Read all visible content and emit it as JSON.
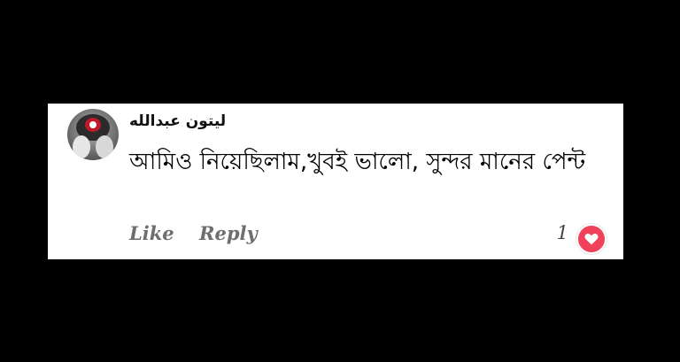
{
  "comment": {
    "author_name": "ليتون عبدالله",
    "text": "আমিও নিয়েছিলাম,খুবই ভালো, সুন্দর মানের পেন্ট",
    "actions": {
      "like_label": "Like",
      "reply_label": "Reply"
    },
    "reactions": {
      "count": "1",
      "icon": "heart-icon",
      "color": "#f0405a"
    }
  }
}
